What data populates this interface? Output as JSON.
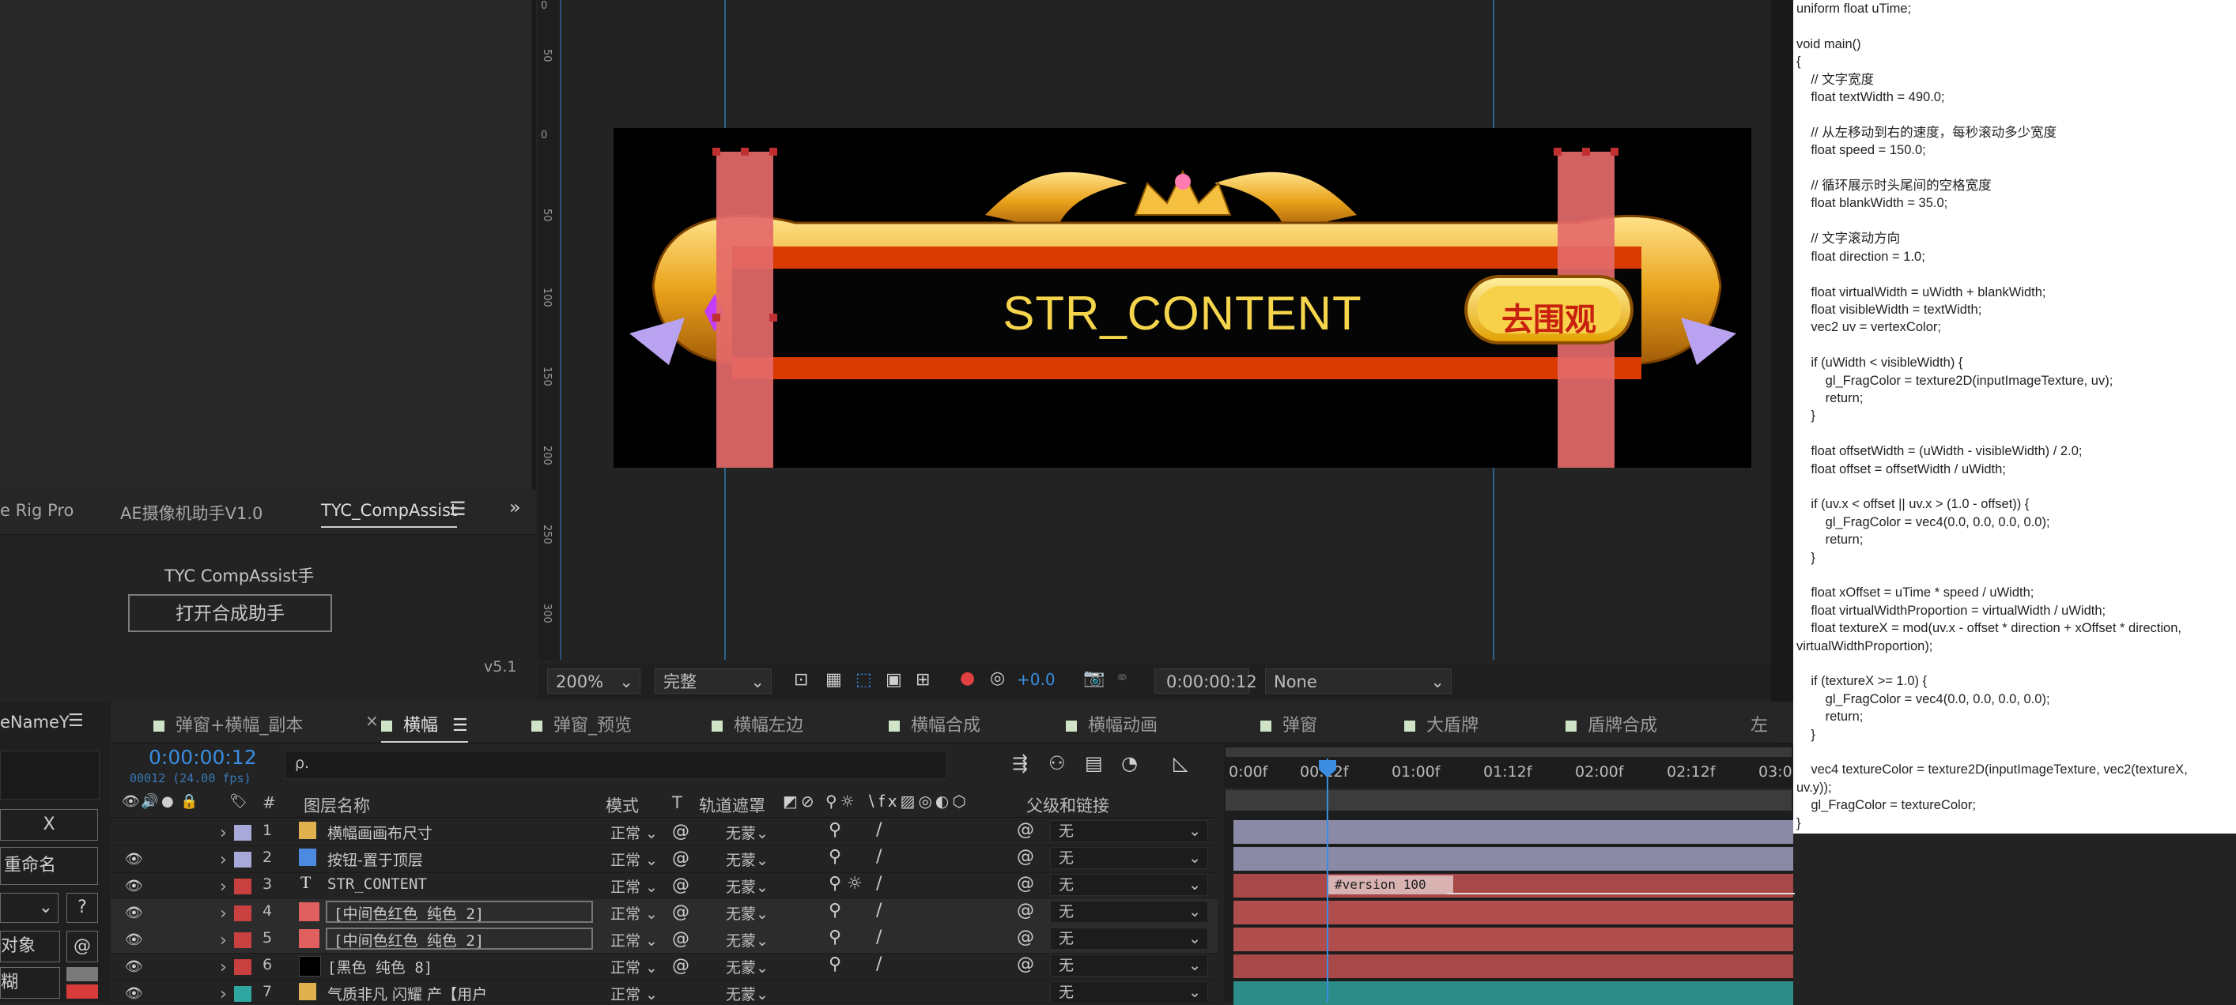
{
  "left_panel": {
    "tabs": [
      "e Rig Pro",
      "AE摄像机助手V1.0",
      "TYC_CompAssist"
    ],
    "plugin_title": "TYC CompAssist手",
    "open_button": "打开合成助手",
    "version": "v5.1"
  },
  "left_strip": {
    "name_label": "eNameY",
    "x_button": "X",
    "rename_button": "重命名",
    "help_button": "?",
    "object_button": "对象",
    "at_button": "@",
    "blur_button": "糊"
  },
  "viewer": {
    "ruler_marks": [
      "0",
      "50",
      "0",
      "50",
      "100",
      "150",
      "200",
      "250",
      "300"
    ],
    "banner_text": "STR_CONTENT",
    "banner_button": "去围观",
    "zoom": "200%",
    "resolution": "完整",
    "exposure": "+0.0",
    "timecode": "0:00:00:12",
    "view": "None"
  },
  "timeline": {
    "tabs": [
      "弹窗+横幅_副本",
      "横幅",
      "弹窗_预览",
      "横幅左边",
      "横幅合成",
      "横幅动画",
      "弹窗",
      "大盾牌",
      "盾牌合成",
      "左"
    ],
    "active_tab": "横幅",
    "timecode": "0:00:00:12",
    "frame_info": "00012 (24.00 fps)",
    "search_placeholder": "ρ.",
    "columns": {
      "num": "#",
      "name": "图层名称",
      "mode": "模式",
      "t": "T",
      "track": "轨道遮罩",
      "parent": "父级和链接"
    },
    "ruler": [
      "0:00f",
      "00:12f",
      "01:00f",
      "01:12f",
      "02:00f",
      "02:12f",
      "03:0"
    ],
    "layers": [
      {
        "num": "1",
        "name": "横幅画画布尺寸",
        "mode": "正常",
        "track": "无蒙",
        "parent": "无",
        "label_color": "#a9a9d9",
        "bar_color": "#8a8aa6"
      },
      {
        "num": "2",
        "name": "按钮-置于顶层",
        "mode": "正常",
        "track": "无蒙",
        "parent": "无",
        "label_color": "#a9a9d9",
        "bar_color": "#8a8aa6"
      },
      {
        "num": "3",
        "name": "STR_CONTENT",
        "mode": "正常",
        "track": "无蒙",
        "parent": "无",
        "label_color": "#c94040",
        "bar_color": "#a84848"
      },
      {
        "num": "4",
        "name": "[中间色红色 纯色 2]",
        "mode": "正常",
        "track": "无蒙",
        "parent": "无",
        "label_color": "#c94040",
        "bar_color": "#b04e4e"
      },
      {
        "num": "5",
        "name": "[中间色红色 纯色 2]",
        "mode": "正常",
        "track": "无蒙",
        "parent": "无",
        "label_color": "#c94040",
        "bar_color": "#b04e4e"
      },
      {
        "num": "6",
        "name": "[黑色 纯色 8]",
        "mode": "正常",
        "track": "无蒙",
        "parent": "无",
        "label_color": "#c94040",
        "bar_color": "#a84848"
      },
      {
        "num": "7",
        "name": "气质非凡 闪耀 产【用户",
        "mode": "正常",
        "track": "无蒙",
        "parent": "无",
        "label_color": "#2fa6a0",
        "bar_color": "#2c8c88"
      }
    ],
    "clip_label": "#version 100"
  },
  "code_lines": [
    "uniform float uTime;",
    "",
    "void main()",
    "{",
    "    // 文字宽度",
    "    float textWidth = 490.0;",
    "",
    "    // 从左移动到右的速度，每秒滚动多少宽度",
    "    float speed = 150.0;",
    "",
    "    // 循环展示时头尾间的空格宽度",
    "    float blankWidth = 35.0;",
    "",
    "    // 文字滚动方向",
    "    float direction = 1.0;",
    "",
    "    float virtualWidth = uWidth + blankWidth;",
    "    float visibleWidth = textWidth;",
    "    vec2 uv = vertexColor;",
    "",
    "    if (uWidth < visibleWidth) {",
    "        gl_FragColor = texture2D(inputImageTexture, uv);",
    "        return;",
    "    }",
    "",
    "    float offsetWidth = (uWidth - visibleWidth) / 2.0;",
    "    float offset = offsetWidth / uWidth;",
    "",
    "    if (uv.x < offset || uv.x > (1.0 - offset)) {",
    "        gl_FragColor = vec4(0.0, 0.0, 0.0, 0.0);",
    "        return;",
    "    }",
    "",
    "    float xOffset = uTime * speed / uWidth;",
    "    float virtualWidthProportion = virtualWidth / uWidth;",
    "    float textureX = mod(uv.x - offset * direction + xOffset * direction,",
    "virtualWidthProportion);",
    "",
    "    if (textureX >= 1.0) {",
    "        gl_FragColor = vec4(0.0, 0.0, 0.0, 0.0);",
    "        return;",
    "    }",
    "",
    "    vec4 textureColor = texture2D(inputImageTexture, vec2(textureX,",
    "uv.y));",
    "    gl_FragColor = textureColor;",
    "}"
  ]
}
